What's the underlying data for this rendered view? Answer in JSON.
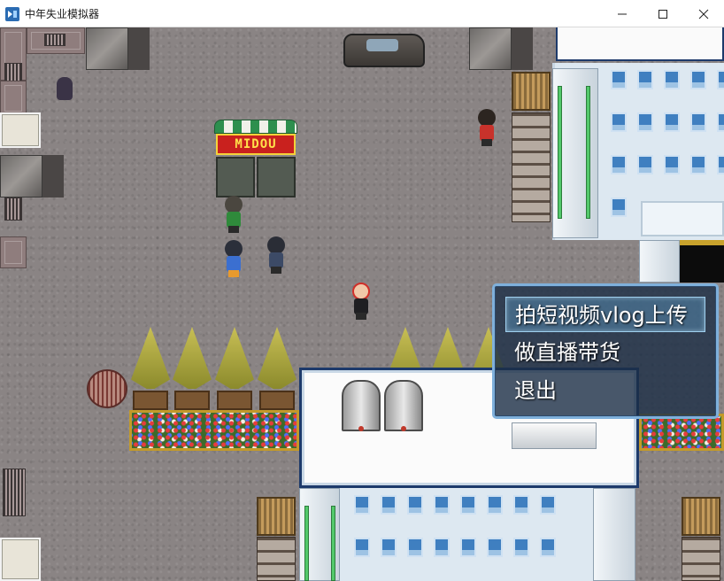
{
  "window": {
    "title": "中年失业模拟器",
    "icon": "rpg-maker-icon",
    "controls": [
      "minimize-icon",
      "maximize-icon",
      "close-icon"
    ]
  },
  "scene": {
    "shop_sign": "MIDOU",
    "colors": {
      "ground": "#8a8484",
      "building": "#dde8f1",
      "menu_bg": "#1c2e46",
      "menu_border": "#7fb0db"
    }
  },
  "menu": {
    "items": [
      {
        "label": "拍短视频vlog上传",
        "selected": true
      },
      {
        "label": "做直播带货",
        "selected": false
      },
      {
        "label": "退出",
        "selected": false
      }
    ]
  }
}
